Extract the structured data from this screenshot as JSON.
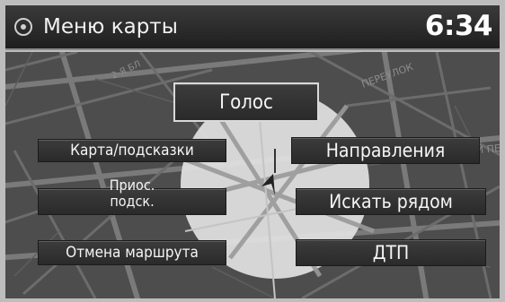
{
  "header": {
    "title": "Меню карты",
    "clock": "6:34",
    "icon": "map-menu-icon"
  },
  "map": {
    "street_labels": [
      "ПЕРЕУЛОК",
      "УЛАНСКИЙ ПЕР",
      "2-Я БЛ"
    ]
  },
  "menu": {
    "voice": "Голос",
    "map_hints": "Карта/подсказки",
    "directions": "Направления",
    "pause_hints_line1": "Приос.",
    "pause_hints_line2": "подск.",
    "search_nearby": "Искать рядом",
    "cancel_route": "Отмена маршрута",
    "traffic": "ДТП"
  },
  "colors": {
    "header_bg": "#262626",
    "button_bg": "#333333",
    "button_text": "#f5f5f5",
    "map_bg": "#4d4d4d"
  }
}
